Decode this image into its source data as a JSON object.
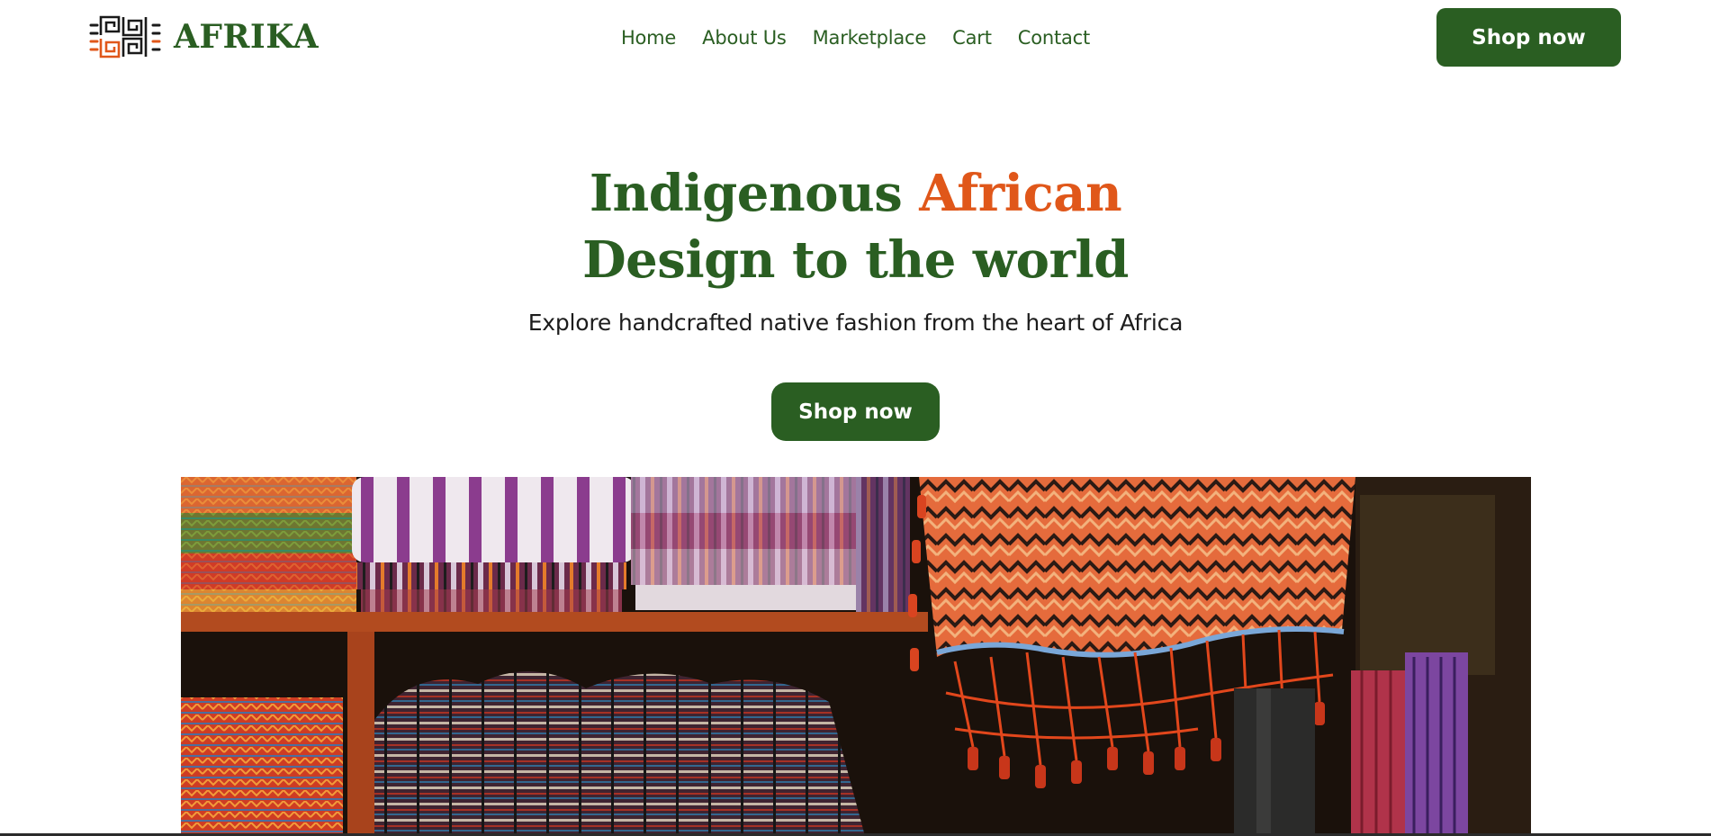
{
  "brand": {
    "name": "AFRIKA",
    "logo_icon": "maze-pattern-logo-icon"
  },
  "nav": {
    "items": [
      {
        "label": "Home"
      },
      {
        "label": "About Us"
      },
      {
        "label": "Marketplace"
      },
      {
        "label": "Cart"
      },
      {
        "label": "Contact"
      }
    ]
  },
  "header": {
    "cta_label": "Shop now"
  },
  "hero": {
    "title_part1": "Indigenous ",
    "title_accent": "African",
    "title_part2": " Design to the world",
    "subtitle": "Explore handcrafted native fashion from the heart of Africa",
    "cta_label": "Shop now",
    "image_subject": "stacks of colorful handwoven textiles on market shelves"
  },
  "colors": {
    "primary_green": "#2a5e22",
    "accent_orange": "#e0571a",
    "text_dark": "#1c1c1c",
    "background": "#ffffff"
  }
}
